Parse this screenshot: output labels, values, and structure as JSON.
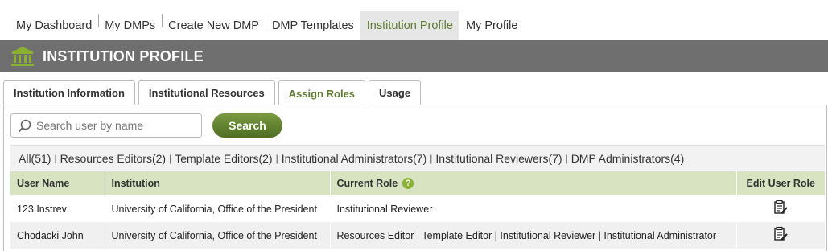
{
  "nav": {
    "items": [
      {
        "label": "My Dashboard"
      },
      {
        "label": "My DMPs"
      },
      {
        "label": "Create New DMP"
      },
      {
        "label": "DMP Templates"
      },
      {
        "label": "Institution Profile"
      },
      {
        "label": "My Profile"
      }
    ],
    "active_index": 4
  },
  "header": {
    "title": "INSTITUTION PROFILE",
    "icon": "institution-icon"
  },
  "tabs": [
    {
      "label": "Institution Information"
    },
    {
      "label": "Institutional Resources"
    },
    {
      "label": "Assign Roles"
    },
    {
      "label": "Usage"
    }
  ],
  "search": {
    "placeholder": "Search user by name",
    "button_label": "Search"
  },
  "filters": [
    {
      "label": "All(51)"
    },
    {
      "label": "Resources Editors(2)"
    },
    {
      "label": "Template Editors(2)"
    },
    {
      "label": "Institutional Administrators(7)"
    },
    {
      "label": "Institutional Reviewers(7)"
    },
    {
      "label": "DMP Administrators(4)"
    }
  ],
  "table": {
    "headers": {
      "user_name": "User Name",
      "institution": "Institution",
      "current_role": "Current Role",
      "help": "?",
      "edit": "Edit User Role"
    },
    "rows": [
      {
        "user_name": "123 Instrev",
        "institution": "University of California, Office of the President",
        "current_role": "Institutional Reviewer"
      },
      {
        "user_name": "Chodacki John",
        "institution": "University of California, Office of the President",
        "current_role": "Resources Editor | Template Editor | Institutional Reviewer | Institutional Administrator"
      }
    ]
  },
  "colors": {
    "accent": "#5d7a2f",
    "header_bg": "#6f6f6f",
    "table_header_bg": "#d8e3c2",
    "icon_green": "#8bb133"
  }
}
